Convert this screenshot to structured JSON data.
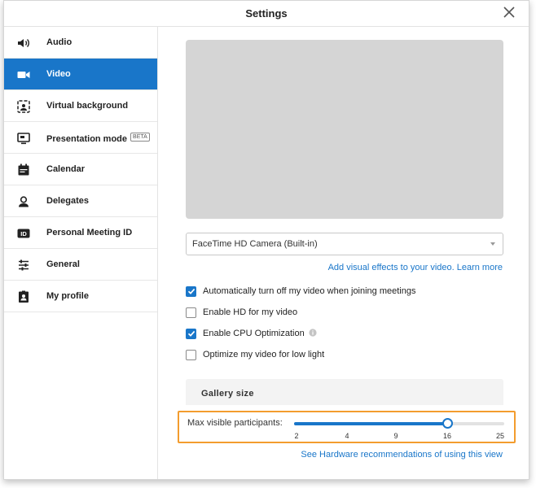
{
  "window": {
    "title": "Settings"
  },
  "sidebar": {
    "items": [
      {
        "label": "Audio",
        "icon": "speaker-icon",
        "active": false
      },
      {
        "label": "Video",
        "icon": "video-camera-icon",
        "active": true
      },
      {
        "label": "Virtual background",
        "icon": "virtual-background-icon",
        "active": false
      },
      {
        "label": "Presentation mode",
        "icon": "presentation-icon",
        "active": false,
        "badge": "BETA"
      },
      {
        "label": "Calendar",
        "icon": "calendar-icon",
        "active": false
      },
      {
        "label": "Delegates",
        "icon": "delegate-user-icon",
        "active": false
      },
      {
        "label": "Personal Meeting ID",
        "icon": "id-badge-icon",
        "active": false
      },
      {
        "label": "General",
        "icon": "sliders-icon",
        "active": false
      },
      {
        "label": "My profile",
        "icon": "profile-card-icon",
        "active": false
      }
    ]
  },
  "video": {
    "camera": "FaceTime HD Camera (Built-in)",
    "visual_effects_link": "Add visual effects to your video. Learn more",
    "options": [
      {
        "label": "Automatically turn off my video when joining meetings",
        "checked": true
      },
      {
        "label": "Enable HD for my video",
        "checked": false
      },
      {
        "label": "Enable CPU Optimization",
        "checked": true,
        "info": true
      },
      {
        "label": "Optimize my video for low light",
        "checked": false
      }
    ]
  },
  "gallery": {
    "title": "Gallery size",
    "slider_label": "Max visible participants:",
    "ticks": [
      "2",
      "4",
      "9",
      "16",
      "25"
    ],
    "selected_tick_index": 3,
    "hardware_link": "See Hardware recommendations of using this view"
  },
  "colors": {
    "accent": "#1976c9",
    "highlight": "#f39c2e",
    "preview": "#d5d5d5"
  }
}
